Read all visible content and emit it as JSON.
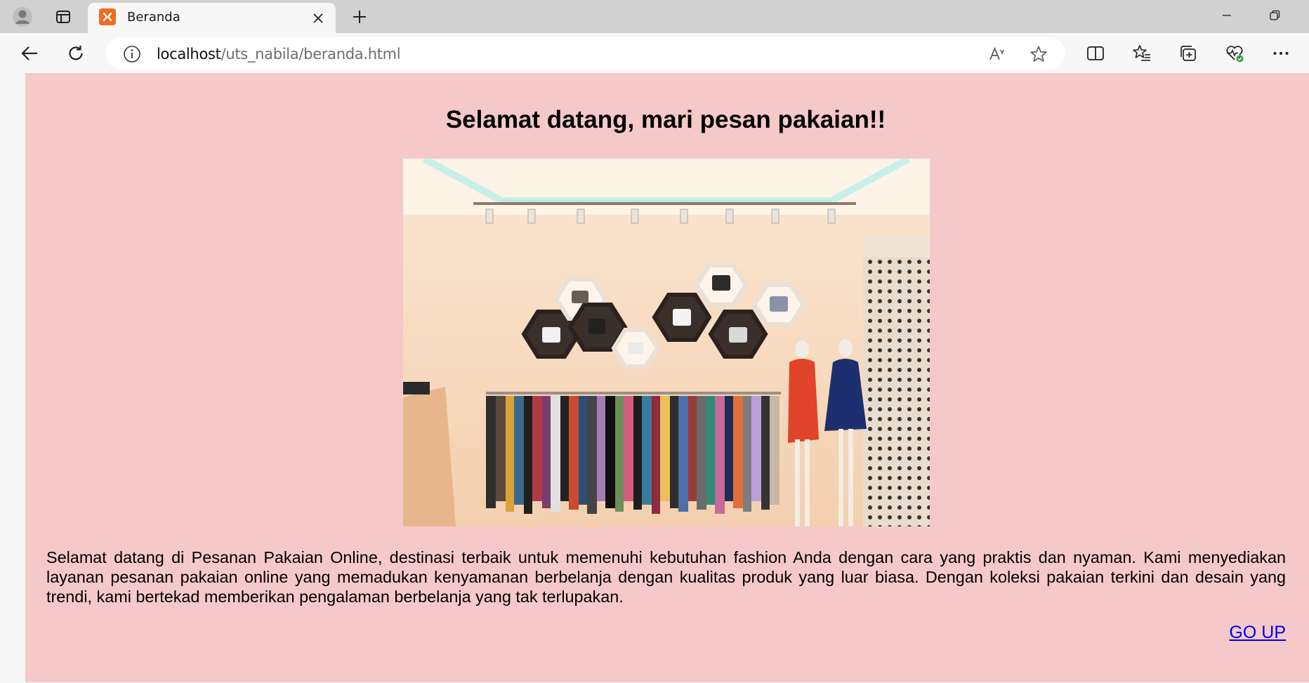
{
  "browser": {
    "tab": {
      "title": "Beranda",
      "favicon": "xampp-icon"
    },
    "address": {
      "host": "localhost",
      "path": "/uts_nabila/beranda.html"
    },
    "accent": "#f26c22"
  },
  "page": {
    "background": "#f5c9c9",
    "heading": "Selamat datang, mari pesan pakaian!!",
    "intro": "Selamat datang di Pesanan Pakaian Online, destinasi terbaik untuk memenuhi kebutuhan fashion Anda dengan cara yang praktis dan nyaman. Kami menyediakan layanan pesanan pakaian online yang memadukan kenyamanan berbelanja dengan kualitas produk yang luar biasa. Dengan koleksi pakaian terkini dan desain yang trendi, kami bertekad memberikan pengalaman berbelanja yang tak terlupakan.",
    "go_up": "GO UP",
    "link_color": "#0000ee"
  }
}
